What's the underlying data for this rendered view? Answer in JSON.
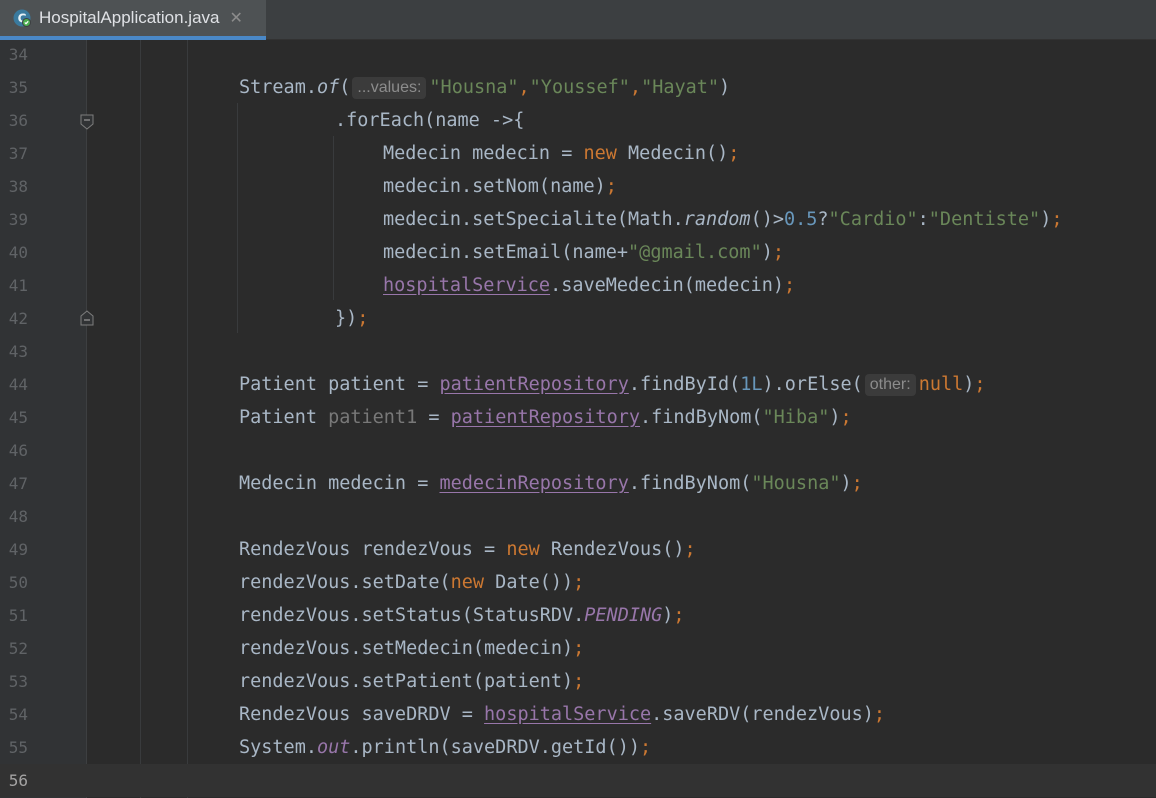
{
  "tab": {
    "title": "HospitalApplication.java",
    "close_glyph": "✕",
    "icon": "java-class-icon"
  },
  "hints": {
    "values": "...values:",
    "other": "other:"
  },
  "lines": [
    {
      "n": "34"
    },
    {
      "n": "35",
      "segs": [
        {
          "t": "Stream.",
          "c": ""
        },
        {
          "t": "of",
          "c": "ital"
        },
        {
          "t": "(",
          "c": ""
        },
        {
          "hint": "values"
        },
        {
          "t": "\"Housna\"",
          "c": "str"
        },
        {
          "t": ",",
          "c": "kw"
        },
        {
          "t": "\"Youssef\"",
          "c": "str"
        },
        {
          "t": ",",
          "c": "kw"
        },
        {
          "t": "\"Hayat\"",
          "c": "str"
        },
        {
          "t": ")",
          "c": ""
        }
      ]
    },
    {
      "n": "36",
      "segs": [
        {
          "t": ".forEach(name ->{",
          "c": ""
        }
      ]
    },
    {
      "n": "37",
      "segs": [
        {
          "t": "Medecin medecin = ",
          "c": ""
        },
        {
          "t": "new",
          "c": "kw"
        },
        {
          "t": " Medecin()",
          "c": ""
        },
        {
          "t": ";",
          "c": "kw"
        }
      ]
    },
    {
      "n": "38",
      "segs": [
        {
          "t": "medecin.setNom(name)",
          "c": ""
        },
        {
          "t": ";",
          "c": "kw"
        }
      ]
    },
    {
      "n": "39",
      "segs": [
        {
          "t": "medecin.setSpecialite(Math.",
          "c": ""
        },
        {
          "t": "random",
          "c": "ital"
        },
        {
          "t": "()>",
          "c": ""
        },
        {
          "t": "0.5",
          "c": "num"
        },
        {
          "t": "?",
          "c": ""
        },
        {
          "t": "\"Cardio\"",
          "c": "str"
        },
        {
          "t": ":",
          "c": ""
        },
        {
          "t": "\"Dentiste\"",
          "c": "str"
        },
        {
          "t": ")",
          "c": ""
        },
        {
          "t": ";",
          "c": "kw"
        }
      ]
    },
    {
      "n": "40",
      "segs": [
        {
          "t": "medecin.setEmail(name+",
          "c": ""
        },
        {
          "t": "\"@gmail.com\"",
          "c": "str"
        },
        {
          "t": ")",
          "c": ""
        },
        {
          "t": ";",
          "c": "kw"
        }
      ]
    },
    {
      "n": "41",
      "segs": [
        {
          "t": "hospitalService",
          "c": "field"
        },
        {
          "t": ".saveMedecin(medecin)",
          "c": ""
        },
        {
          "t": ";",
          "c": "kw"
        }
      ]
    },
    {
      "n": "42",
      "segs": [
        {
          "t": "})",
          "c": ""
        },
        {
          "t": ";",
          "c": "kw"
        }
      ]
    },
    {
      "n": "43"
    },
    {
      "n": "44",
      "segs": [
        {
          "t": "Patient patient = ",
          "c": ""
        },
        {
          "t": "patientRepository",
          "c": "field"
        },
        {
          "t": ".findById(",
          "c": ""
        },
        {
          "t": "1L",
          "c": "num"
        },
        {
          "t": ").orElse(",
          "c": ""
        },
        {
          "hint": "other"
        },
        {
          "t": "null",
          "c": "kw"
        },
        {
          "t": ")",
          "c": ""
        },
        {
          "t": ";",
          "c": "kw"
        }
      ]
    },
    {
      "n": "45",
      "segs": [
        {
          "t": "Patient ",
          "c": ""
        },
        {
          "t": "patient1",
          "c": "unused"
        },
        {
          "t": " = ",
          "c": ""
        },
        {
          "t": "patientRepository",
          "c": "field"
        },
        {
          "t": ".findByNom(",
          "c": ""
        },
        {
          "t": "\"Hiba\"",
          "c": "str"
        },
        {
          "t": ")",
          "c": ""
        },
        {
          "t": ";",
          "c": "kw"
        }
      ]
    },
    {
      "n": "46"
    },
    {
      "n": "47",
      "segs": [
        {
          "t": "Medecin medecin = ",
          "c": ""
        },
        {
          "t": "medecinRepository",
          "c": "field"
        },
        {
          "t": ".findByNom(",
          "c": ""
        },
        {
          "t": "\"Housna\"",
          "c": "str"
        },
        {
          "t": ")",
          "c": ""
        },
        {
          "t": ";",
          "c": "kw"
        }
      ]
    },
    {
      "n": "48"
    },
    {
      "n": "49",
      "segs": [
        {
          "t": "RendezVous rendezVous = ",
          "c": ""
        },
        {
          "t": "new",
          "c": "kw"
        },
        {
          "t": " RendezVous()",
          "c": ""
        },
        {
          "t": ";",
          "c": "kw"
        }
      ]
    },
    {
      "n": "50",
      "segs": [
        {
          "t": "rendezVous.setDate(",
          "c": ""
        },
        {
          "t": "new",
          "c": "kw"
        },
        {
          "t": " Date())",
          "c": ""
        },
        {
          "t": ";",
          "c": "kw"
        }
      ]
    },
    {
      "n": "51",
      "segs": [
        {
          "t": "rendezVous.setStatus(StatusRDV.",
          "c": ""
        },
        {
          "t": "PENDING",
          "c": "static"
        },
        {
          "t": ")",
          "c": ""
        },
        {
          "t": ";",
          "c": "kw"
        }
      ]
    },
    {
      "n": "52",
      "segs": [
        {
          "t": "rendezVous.setMedecin(medecin)",
          "c": ""
        },
        {
          "t": ";",
          "c": "kw"
        }
      ]
    },
    {
      "n": "53",
      "segs": [
        {
          "t": "rendezVous.setPatient(patient)",
          "c": ""
        },
        {
          "t": ";",
          "c": "kw"
        }
      ]
    },
    {
      "n": "54",
      "segs": [
        {
          "t": "RendezVous saveDRDV = ",
          "c": ""
        },
        {
          "t": "hospitalService",
          "c": "field"
        },
        {
          "t": ".saveRDV(rendezVous)",
          "c": ""
        },
        {
          "t": ";",
          "c": "kw"
        }
      ]
    },
    {
      "n": "55",
      "segs": [
        {
          "t": "System.",
          "c": ""
        },
        {
          "t": "out",
          "c": "static"
        },
        {
          "t": ".println(saveDRDV.getId())",
          "c": ""
        },
        {
          "t": ";",
          "c": "kw"
        }
      ]
    },
    {
      "n": "56"
    }
  ],
  "colors": {
    "background": "#2b2b2b",
    "gutter": "#313335",
    "keyword": "#cc7832",
    "string": "#6a8759",
    "number": "#6897bb",
    "field": "#9876aa",
    "text": "#a9b7c6"
  }
}
